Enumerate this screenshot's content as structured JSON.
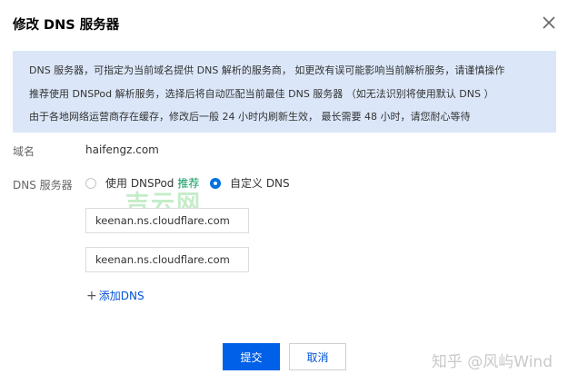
{
  "dialog": {
    "title": "修改 DNS 服务器"
  },
  "notice": {
    "line1": "DNS 服务器，可指定为当前域名提供 DNS 解析的服务商， 如更改有误可能影响当前解析服务，请谨慎操作",
    "line2": "推荐使用 DNSPod 解析服务，选择后将自动匹配当前最佳 DNS 服务器 （如无法识别将使用默认 DNS ）",
    "line3": "由于各地网络运营商存在缓存，修改后一般 24 小时内刷新生效， 最长需要 48 小时，请您耐心等待"
  },
  "domain": {
    "label": "域名",
    "value": "haifengz.com"
  },
  "dns_server": {
    "label": "DNS 服务器",
    "option_dnspod": "使用 DNSPod",
    "option_dnspod_tag": "推荐",
    "option_custom": "自定义 DNS",
    "selected": "custom",
    "servers": [
      "keenan.ns.cloudflare.com",
      "keenan.ns.cloudflare.com"
    ],
    "add_label": "添加DNS"
  },
  "buttons": {
    "submit": "提交",
    "cancel": "取消"
  },
  "watermarks": {
    "center": "吉云网",
    "corner": "知乎 @风屿Wind"
  },
  "colors": {
    "primary": "#0060e8",
    "notice_bg": "#dbe7f9",
    "recommend": "#0a9a5e"
  }
}
